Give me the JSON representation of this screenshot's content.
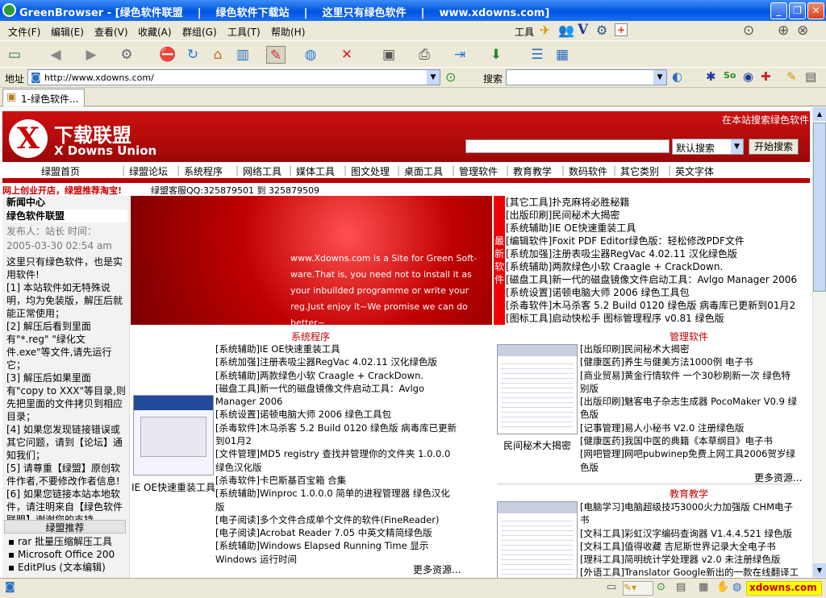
{
  "window": {
    "title": "GreenBrowser - [绿色软件联盟    |    绿色软件下载站    |    这里只有绿色软件    |    www.xdowns.com]"
  },
  "menubar": {
    "items": [
      "文件(F)",
      "编辑(E)",
      "查看(V)",
      "收藏(A)",
      "群组(G)",
      "工具(T)",
      "帮助(H)"
    ],
    "tools_label": "工具"
  },
  "address": {
    "label": "地址",
    "url": "http://www.xdowns.com/",
    "search_label": "搜索",
    "search_value": ""
  },
  "tabs": [
    {
      "label": "1-绿色软件..."
    }
  ],
  "site": {
    "logo_cn": "下载联盟",
    "logo_x": "X",
    "logo_en": "X Downs Union",
    "site_search_label": "在本站搜索绿色软件",
    "search_select": "默认搜索",
    "search_button": "开始搜索",
    "nav": [
      "绿盟首页",
      "绿盟论坛",
      "系统程序",
      "网络工具",
      "媒体工具",
      "图文处理",
      "桌面工具",
      "管理软件",
      "教育教学",
      "数码软件",
      "其它类别",
      "英文字体"
    ],
    "promo": "网上创业开店，绿盟推荐淘宝!",
    "service": "绿盟客服QQ:325879501 到  325879509"
  },
  "left": {
    "news_title": "新闻中心",
    "news_sub": "绿色软件联盟",
    "meta": "发布人：站长  时间：",
    "date": "2005-03-30 02:54 am",
    "paragraphs": [
      "这里只有绿色软件，也是实用软件!",
      "[1] 本站软件如无特殊说明，均为免装版，解压后就能正常使用；",
      "[2] 解压后看到里面有\"*.reg\" \"绿化文件.exe\"等文件,请先运行它；",
      "[3] 解压后如果里面有\"copy to XXX\"等目录,则先把里面的文件拷贝到相应目录；",
      "[4] 如果您发现链接错误或其它问题，请到【论坛】通知我们；",
      "[5] 请尊重【绿盟】原创软件作者,不要修改作者信息!",
      "[6] 如果您链接本站本地软件，请注明来自【绿色软件联盟】谢谢您的支持。"
    ],
    "rec_title": "绿盟推荐",
    "rec": [
      "rar 批量压缩解压工具",
      "Microsoft Office 200",
      "EditPlus (文本编辑)"
    ]
  },
  "hero_text": "www.Xdowns.com is a Site for Green Soft-ware.That is, you need not to install it as your inbuilded programme or  write your reg.Just enjoy it~We promise we can do better~",
  "latest_tag": "最新软件",
  "latest": [
    "[其它工具]扑克麻将必胜秘籍",
    "[出版印刷]民间秘术大揭密",
    "[系统辅助]IE OE快速重装工具",
    "[编辑软件]Foxit PDF Editor绿色版：轻松修改PDF文件",
    "[系统加强]注册表吸尘器RegVac 4.02.11 汉化绿色版",
    "[系统辅助]两款绿色小软  Craagle + CrackDown.",
    "[磁盘工具]新一代的磁盘镜像文件启动工具：Avlgo Manager 2006",
    "[系统设置]诺顿电脑大师  2006 绿色工具包",
    "[杀毒软件]木马杀客  5.2 Build 0120 绿色版  病毒库已更新到01月2",
    "[图标工具]启动快松手  图标管理程序  v0.81 绿色版"
  ],
  "sys": {
    "title": "系统程序",
    "thumb_caption": "IE OE快速重装工具",
    "items": [
      "[系统辅助]IE OE快速重装工具",
      "[系统加强]注册表吸尘器RegVac 4.02.11 汉化绿色版",
      "[系统辅助]两款绿色小软  Craagle + CrackDown.",
      "[磁盘工具]新一代的磁盘镜像文件启动工具：Avlgo Manager 2006",
      "[系统设置]诺顿电脑大师  2006 绿色工具包",
      "[杀毒软件]木马杀客  5.2 Build 0120 绿色版  病毒库已更新到01月2",
      "[文件管理]MD5 registry 查找并管理你的文件夹  1.0.0.0绿色汉化版",
      "[杀毒软件]卡巴斯基百宝箱  合集",
      "[系统辅助]Winproc 1.0.0.0 简单的进程管理器  绿色汉化版",
      "[电子阅读]多个文件合成单个文件的软件(FineReader)",
      "[电子阅读]Acrobat Reader 7.05 中英文精简绿色版",
      "[系统辅助]Windows Elapsed Running Time 显示 Windows 运行时间"
    ],
    "more": "更多资源..."
  },
  "mgmt": {
    "title": "管理软件",
    "thumb_caption": "民间秘术大揭密",
    "items": [
      "[出版印刷]民间秘术大揭密",
      "[健康医药]养生与健美方法1000例  电子书",
      "[商业贸易]黄金行情软件  一个30秒刷新一次  绿色特别版",
      "[出版印刷]魅客电子杂志生成器  PocoMaker V0.9 绿色版",
      "[记事管理]易人小秘书  V2.0 注册绿色版",
      "[健康医药]我国中医的典籍《本草纲目》电子书",
      "[网吧管理]网吧pubwinep免费上网工具2006贺岁绿色版"
    ],
    "more": "更多资源..."
  },
  "edu": {
    "title": "教育教学",
    "items": [
      "[电脑学习]电脑超级技巧3000火力加强版  CHM电子书",
      "[文科工具]彩虹汉字编码查询器  V1.4.4.521 绿色版",
      "[文科工具]值得收藏  吉尼斯世界记录大全电子书",
      "[理科工具]简明统计学处理器  v2.0 未注册绿色版",
      "[外语工具]Translator Google新出的一款在线翻译工"
    ]
  },
  "status": {
    "site_badge": "xdowns.com"
  }
}
